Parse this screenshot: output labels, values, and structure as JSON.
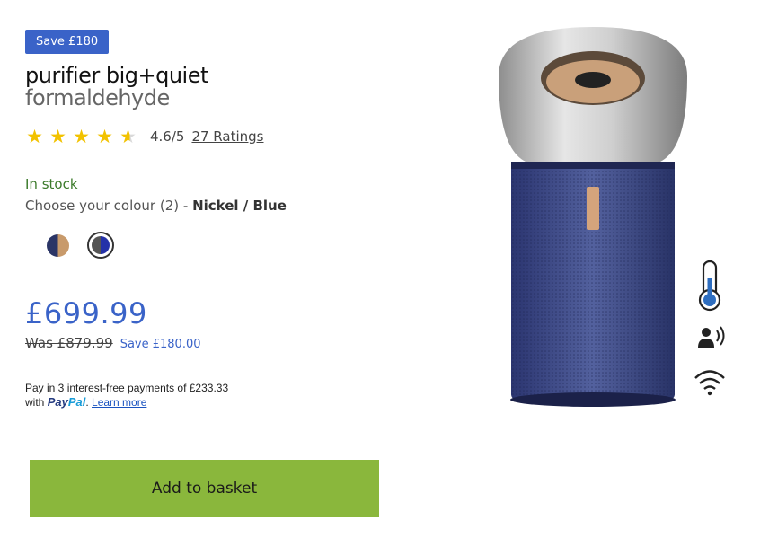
{
  "badge": {
    "text": "Save £180"
  },
  "product": {
    "title_line1": "purifier big+quiet",
    "title_line2": "formaldehyde"
  },
  "rating": {
    "stars": 4.6,
    "value_text": "4.6/5",
    "ratings_link": "27 Ratings"
  },
  "stock": {
    "status": "In stock"
  },
  "colour": {
    "prompt": "Choose your colour (2) -",
    "selected": "Nickel / Blue",
    "swatches": [
      {
        "name": "Prussian Blue / Copper"
      },
      {
        "name": "Nickel / Blue",
        "selected": true
      }
    ]
  },
  "pricing": {
    "price": "£699.99",
    "was": "Was £879.99",
    "save": "Save £180.00"
  },
  "paypal": {
    "line1": "Pay in 3 interest-free payments of £233.33",
    "with": "with",
    "logo_pay": "Pay",
    "logo_pal": "Pal",
    "learn_more": "Learn more"
  },
  "cta": {
    "add_to_basket": "Add to basket"
  },
  "features": [
    "thermometer-icon",
    "voice-control-icon",
    "wifi-icon"
  ],
  "colors": {
    "accent": "#3a63c8",
    "cta": "#8ab73c",
    "stock": "#3b7a2a",
    "star": "#f2c200"
  }
}
